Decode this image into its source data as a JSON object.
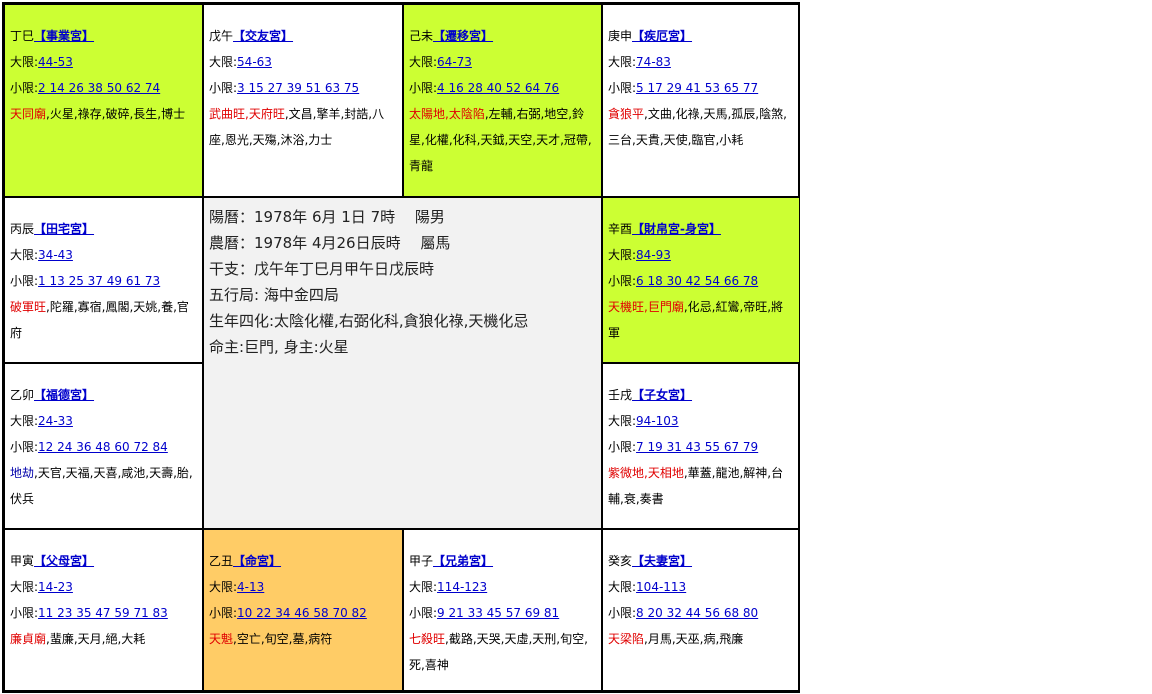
{
  "labels": {
    "da": "大限:",
    "xiao": "小限:"
  },
  "center": {
    "lines": [
      "陽曆：1978年 6月 1日 7時　 陽男",
      "農曆：1978年 4月26日辰時　 屬馬",
      "干支：戊午年丁巳月甲午日戊辰時",
      "五行局: 海中金四局",
      "生年四化:太陰化權,右弼化科,貪狼化祿,天機化忌",
      "命主:巨門, 身主:火星"
    ]
  },
  "palaces": [
    {
      "ganzhi": "丁巳",
      "name": "【事業宮】",
      "da": "44-53",
      "xiao": "2 14 26 38 50 62 74",
      "stars": [
        {
          "t": "天同廟",
          "c": "red"
        },
        {
          "t": ",火星,祿存,破碎,長生,博士",
          "c": "black"
        }
      ]
    },
    {
      "ganzhi": "戊午",
      "name": "【交友宮】",
      "da": "54-63",
      "xiao": "3 15 27 39 51 63 75",
      "stars": [
        {
          "t": "武曲旺,天府旺",
          "c": "red"
        },
        {
          "t": ",文昌,擎羊,封誥,八座,恩光,天殤,沐浴,力士",
          "c": "black"
        }
      ]
    },
    {
      "ganzhi": "己未",
      "name": "【遷移宮】",
      "da": "64-73",
      "xiao": "4 16 28 40 52 64 76",
      "stars": [
        {
          "t": "太陽地,太陰陷",
          "c": "red"
        },
        {
          "t": ",左輔,右弼,地空,鈴星,化權,化科,天鉞,天空,天才,冠帶,青龍",
          "c": "black"
        }
      ]
    },
    {
      "ganzhi": "庚申",
      "name": "【疾厄宮】",
      "da": "74-83",
      "xiao": "5 17 29 41 53 65 77",
      "stars": [
        {
          "t": "貪狼平",
          "c": "red"
        },
        {
          "t": ",文曲,化祿,天馬,孤辰,陰煞,三台,天貴,天使,臨官,小耗",
          "c": "black"
        }
      ]
    },
    {
      "ganzhi": "丙辰",
      "name": "【田宅宮】",
      "da": "34-43",
      "xiao": "1 13 25 37 49 61 73",
      "stars": [
        {
          "t": "破軍旺",
          "c": "red"
        },
        {
          "t": ",陀羅,寡宿,鳳閣,天姚,養,官府",
          "c": "black"
        }
      ]
    },
    {
      "ganzhi": "辛酉",
      "name": "【財帛宮-身宮】",
      "da": "84-93",
      "xiao": "6 18 30 42 54 66 78",
      "stars": [
        {
          "t": "天機旺,巨門廟",
          "c": "red"
        },
        {
          "t": ",化忌,紅鸞,帝旺,將軍",
          "c": "black"
        }
      ]
    },
    {
      "ganzhi": "乙卯",
      "name": "【福德宮】",
      "da": "24-33",
      "xiao": "12 24 36 48 60 72 84",
      "stars": [
        {
          "t": "地劫",
          "c": "blue"
        },
        {
          "t": ",天官,天福,天喜,咸池,天壽,胎,伏兵",
          "c": "black"
        }
      ]
    },
    {
      "ganzhi": "壬戌",
      "name": "【子女宮】",
      "da": "94-103",
      "xiao": "7 19 31 43 55 67 79",
      "stars": [
        {
          "t": "紫微地,天相地",
          "c": "red"
        },
        {
          "t": ",華蓋,龍池,解神,台輔,衰,奏書",
          "c": "black"
        }
      ]
    },
    {
      "ganzhi": "甲寅",
      "name": "【父母宮】",
      "da": "14-23",
      "xiao": "11 23 35 47 59 71 83",
      "stars": [
        {
          "t": "廉貞廟",
          "c": "red"
        },
        {
          "t": ",蜚廉,天月,絕,大耗",
          "c": "black"
        }
      ]
    },
    {
      "ganzhi": "乙丑",
      "name": "【命宮】",
      "da": "4-13",
      "xiao": "10 22 34 46 58 70 82",
      "stars": [
        {
          "t": "天魁",
          "c": "red"
        },
        {
          "t": ",空亡,旬空,墓,病符",
          "c": "black"
        }
      ]
    },
    {
      "ganzhi": "甲子",
      "name": "【兄弟宮】",
      "da": "114-123",
      "xiao": "9 21 33 45 57 69 81",
      "stars": [
        {
          "t": "七殺旺",
          "c": "red"
        },
        {
          "t": ",截路,天哭,天虛,天刑,旬空,死,喜神",
          "c": "black"
        }
      ]
    },
    {
      "ganzhi": "癸亥",
      "name": "【夫妻宮】",
      "da": "104-113",
      "xiao": "8 20 32 44 56 68 80",
      "stars": [
        {
          "t": "天梁陷",
          "c": "red"
        },
        {
          "t": ",月馬,天巫,病,飛廉",
          "c": "black"
        }
      ]
    }
  ]
}
